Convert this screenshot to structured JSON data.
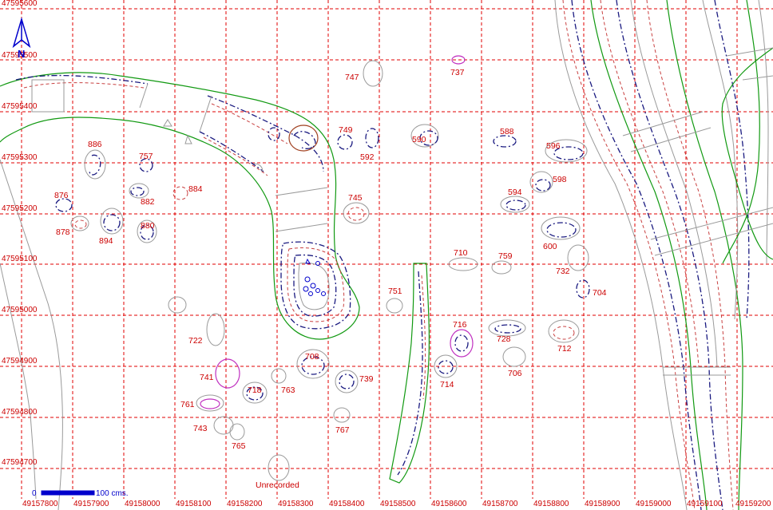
{
  "grid": {
    "x_labels": [
      "49157800",
      "49157900",
      "49158000",
      "49158100",
      "49158200",
      "49158300",
      "49158400",
      "49158500",
      "49158600",
      "49158700",
      "49158800",
      "49158900",
      "49159000",
      "49159100",
      "49159200"
    ],
    "y_labels": [
      "47595600",
      "47595500",
      "47595400",
      "47595300",
      "47595200",
      "47595100",
      "47595000",
      "47594900",
      "47594800",
      "47594700"
    ],
    "line_color": "#e00000",
    "label_color": "#cc0000"
  },
  "features": [
    {
      "id": "747",
      "type": "pit"
    },
    {
      "id": "737",
      "type": "pit"
    },
    {
      "id": "749",
      "type": "pit"
    },
    {
      "id": "592",
      "type": "pit"
    },
    {
      "id": "590",
      "type": "pit"
    },
    {
      "id": "588",
      "type": "pit"
    },
    {
      "id": "596",
      "type": "pit"
    },
    {
      "id": "598",
      "type": "pit"
    },
    {
      "id": "594",
      "type": "pit"
    },
    {
      "id": "886",
      "type": "pit"
    },
    {
      "id": "757",
      "type": "pit"
    },
    {
      "id": "884",
      "type": "pit"
    },
    {
      "id": "882",
      "type": "pit"
    },
    {
      "id": "876",
      "type": "pit"
    },
    {
      "id": "878",
      "type": "pit"
    },
    {
      "id": "894",
      "type": "pit"
    },
    {
      "id": "880",
      "type": "pit"
    },
    {
      "id": "745",
      "type": "pit"
    },
    {
      "id": "600",
      "type": "pit"
    },
    {
      "id": "710",
      "type": "pit"
    },
    {
      "id": "759",
      "type": "pit"
    },
    {
      "id": "732",
      "type": "pit"
    },
    {
      "id": "704",
      "type": "pit"
    },
    {
      "id": "751",
      "type": "pit"
    },
    {
      "id": "716",
      "type": "pit"
    },
    {
      "id": "728",
      "type": "pit"
    },
    {
      "id": "712",
      "type": "pit"
    },
    {
      "id": "706",
      "type": "pit"
    },
    {
      "id": "714",
      "type": "pit"
    },
    {
      "id": "708",
      "type": "pit"
    },
    {
      "id": "739",
      "type": "pit"
    },
    {
      "id": "722",
      "type": "pit"
    },
    {
      "id": "741",
      "type": "pit"
    },
    {
      "id": "718",
      "type": "pit"
    },
    {
      "id": "763",
      "type": "pit"
    },
    {
      "id": "761",
      "type": "pit"
    },
    {
      "id": "743",
      "type": "pit"
    },
    {
      "id": "765",
      "type": "pit"
    },
    {
      "id": "767",
      "type": "pit"
    },
    {
      "id": "Unrecorded",
      "type": "pit"
    }
  ],
  "scale_bar": {
    "start": "0",
    "end": "100 cms.",
    "color": "#0000cc"
  },
  "north_arrow": {
    "letter": "N",
    "color": "#0000cc"
  },
  "colors": {
    "outline": "#1a1a80",
    "cut": "#c84040",
    "boundary": "#119911",
    "grey": "#9a9a9a",
    "pink": "#c030c0"
  }
}
